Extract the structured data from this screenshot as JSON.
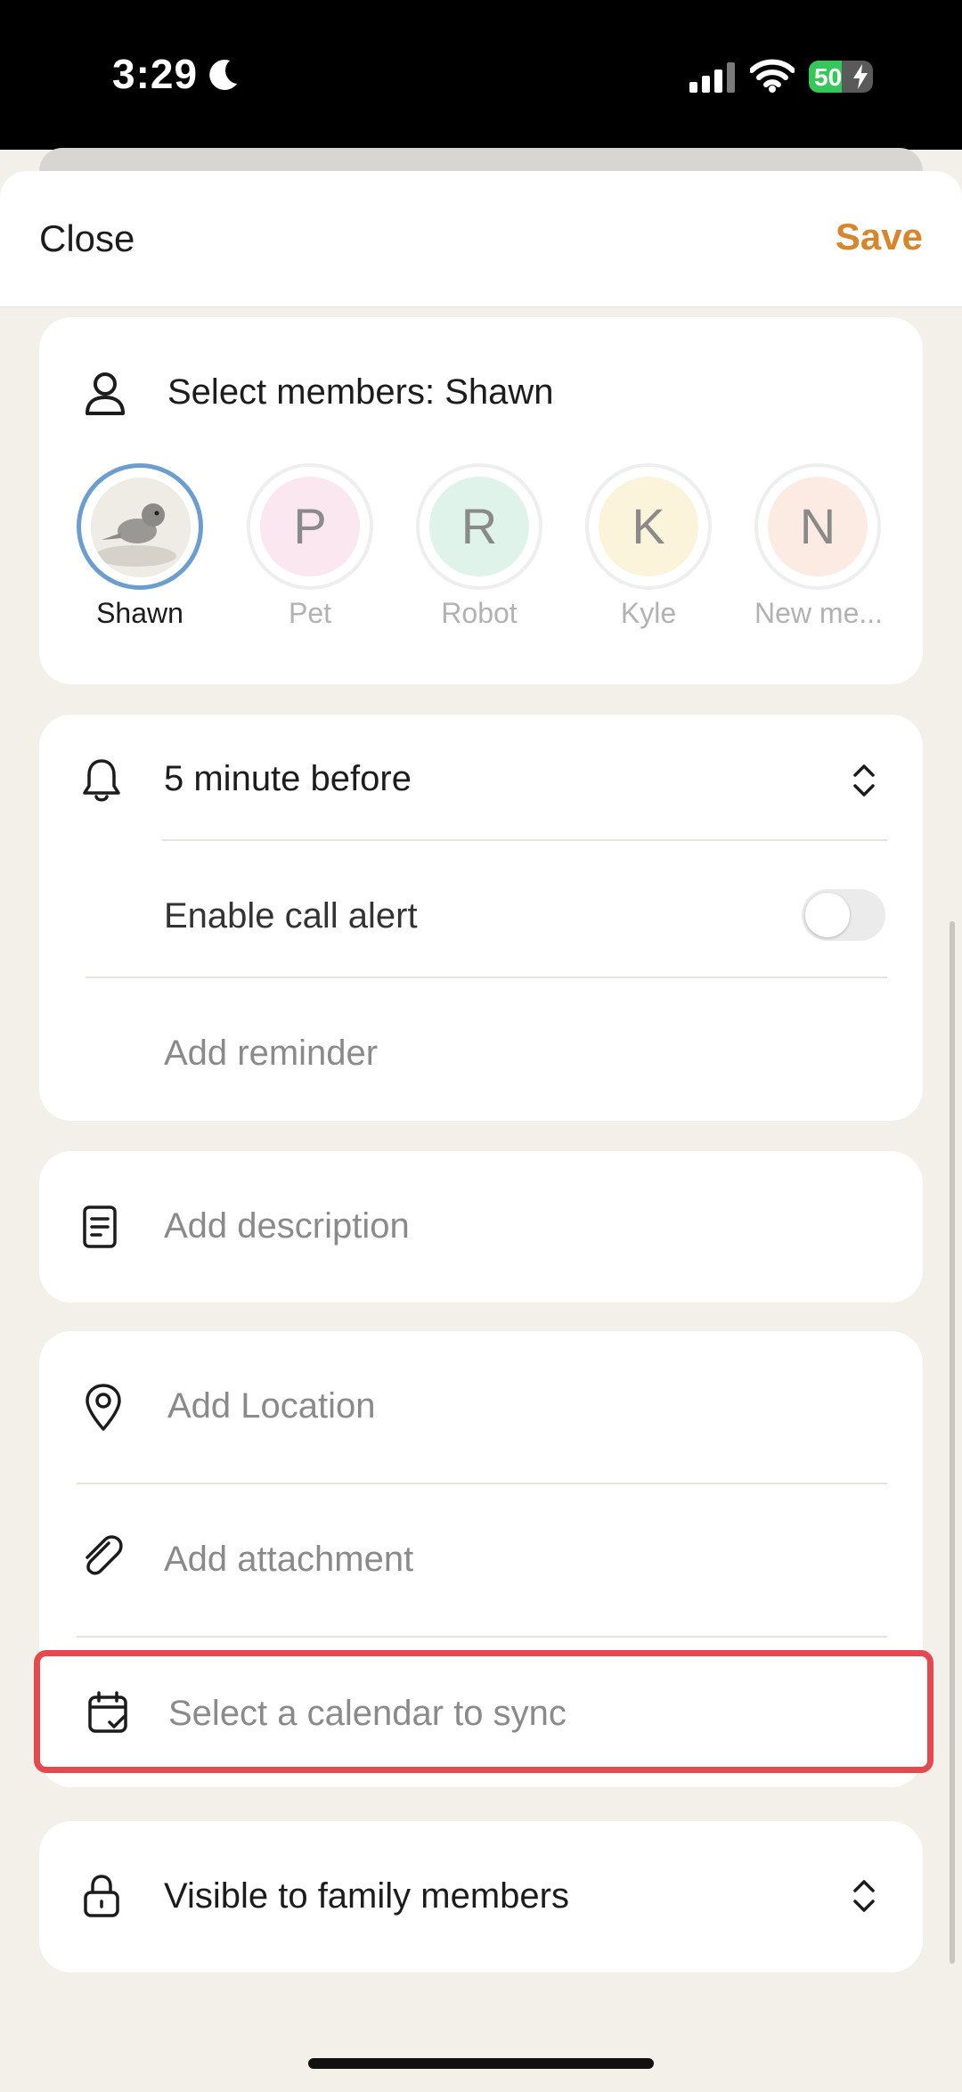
{
  "status_bar": {
    "time": "3:29",
    "battery_level": "50",
    "icons": [
      "moon-icon",
      "cellular-signal-icon",
      "wifi-icon",
      "battery-charging-icon"
    ]
  },
  "header": {
    "close_label": "Close",
    "save_label": "Save",
    "save_color": "#d8862c"
  },
  "members": {
    "label": "Select members: Shawn",
    "items": [
      {
        "name": "Shawn",
        "initial": "",
        "selected": true,
        "color": "#6b9ecf"
      },
      {
        "name": "Pet",
        "initial": "P",
        "selected": false,
        "color": "#fbe7ef"
      },
      {
        "name": "Robot",
        "initial": "R",
        "selected": false,
        "color": "#dff3ea"
      },
      {
        "name": "Kyle",
        "initial": "K",
        "selected": false,
        "color": "#fbf3da"
      },
      {
        "name": "New me...",
        "initial": "N",
        "selected": false,
        "color": "#fcebe3"
      }
    ]
  },
  "reminder": {
    "value": "5 minute before",
    "call_alert_label": "Enable call alert",
    "call_alert_enabled": false,
    "add_reminder_label": "Add reminder"
  },
  "description": {
    "placeholder": "Add description"
  },
  "details": {
    "location_placeholder": "Add Location",
    "attachment_label": "Add attachment",
    "calendar_sync_placeholder": "Select a calendar to sync",
    "highlight_color": "#e5484d"
  },
  "visibility": {
    "value": "Visible to family members"
  }
}
